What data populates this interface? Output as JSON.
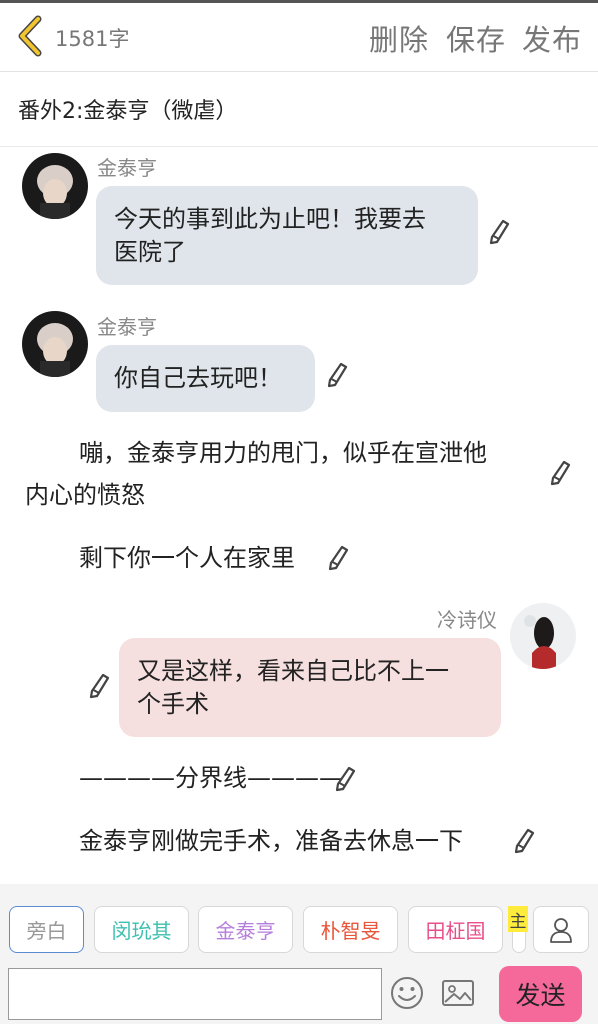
{
  "header": {
    "word_count": "1581字",
    "delete_label": "删除",
    "save_label": "保存",
    "publish_label": "发布"
  },
  "story": {
    "title": "番外2:金泰亨（微虐）"
  },
  "messages": [
    {
      "speaker": "金泰亨",
      "text_lines": [
        "今天的事到此为止吧！我要去",
        "医院了"
      ]
    },
    {
      "speaker": "金泰亨",
      "text_lines": [
        "你自己去玩吧！"
      ]
    },
    {
      "narration_lines": [
        "嘣，金泰亨用力的甩门，似乎在宣泄他",
        "内心的愤怒"
      ]
    },
    {
      "narration_lines": [
        "剩下你一个人在家里"
      ]
    },
    {
      "speaker": "冷诗仪",
      "text_lines": [
        "又是这样，看来自己比不上一",
        "个手术"
      ]
    },
    {
      "narration_lines": [
        "————分界线————"
      ]
    },
    {
      "narration_lines": [
        "金泰亨刚做完手术，准备去休息一下"
      ]
    }
  ],
  "characters": [
    {
      "label": "旁白",
      "color": "#999999"
    },
    {
      "label": "闵玧其",
      "color": "#3dbfb0"
    },
    {
      "label": "金泰亨",
      "color": "#b57edc"
    },
    {
      "label": "朴智旻",
      "color": "#e8563b"
    },
    {
      "label": "田柾国",
      "color": "#e84f8a"
    }
  ],
  "main_badge": "主",
  "composer": {
    "placeholder": "",
    "send_label": "发送"
  },
  "icons": {
    "back": "chevron-left-icon",
    "edit": "pencil-icon",
    "user": "user-icon",
    "emoji": "smiley-icon",
    "image": "image-icon"
  },
  "colors": {
    "send_button": "#f4699a",
    "left_bubble": "#dfe5eb",
    "right_bubble": "#f5dfdf",
    "back_chevron": "#f2c530"
  }
}
